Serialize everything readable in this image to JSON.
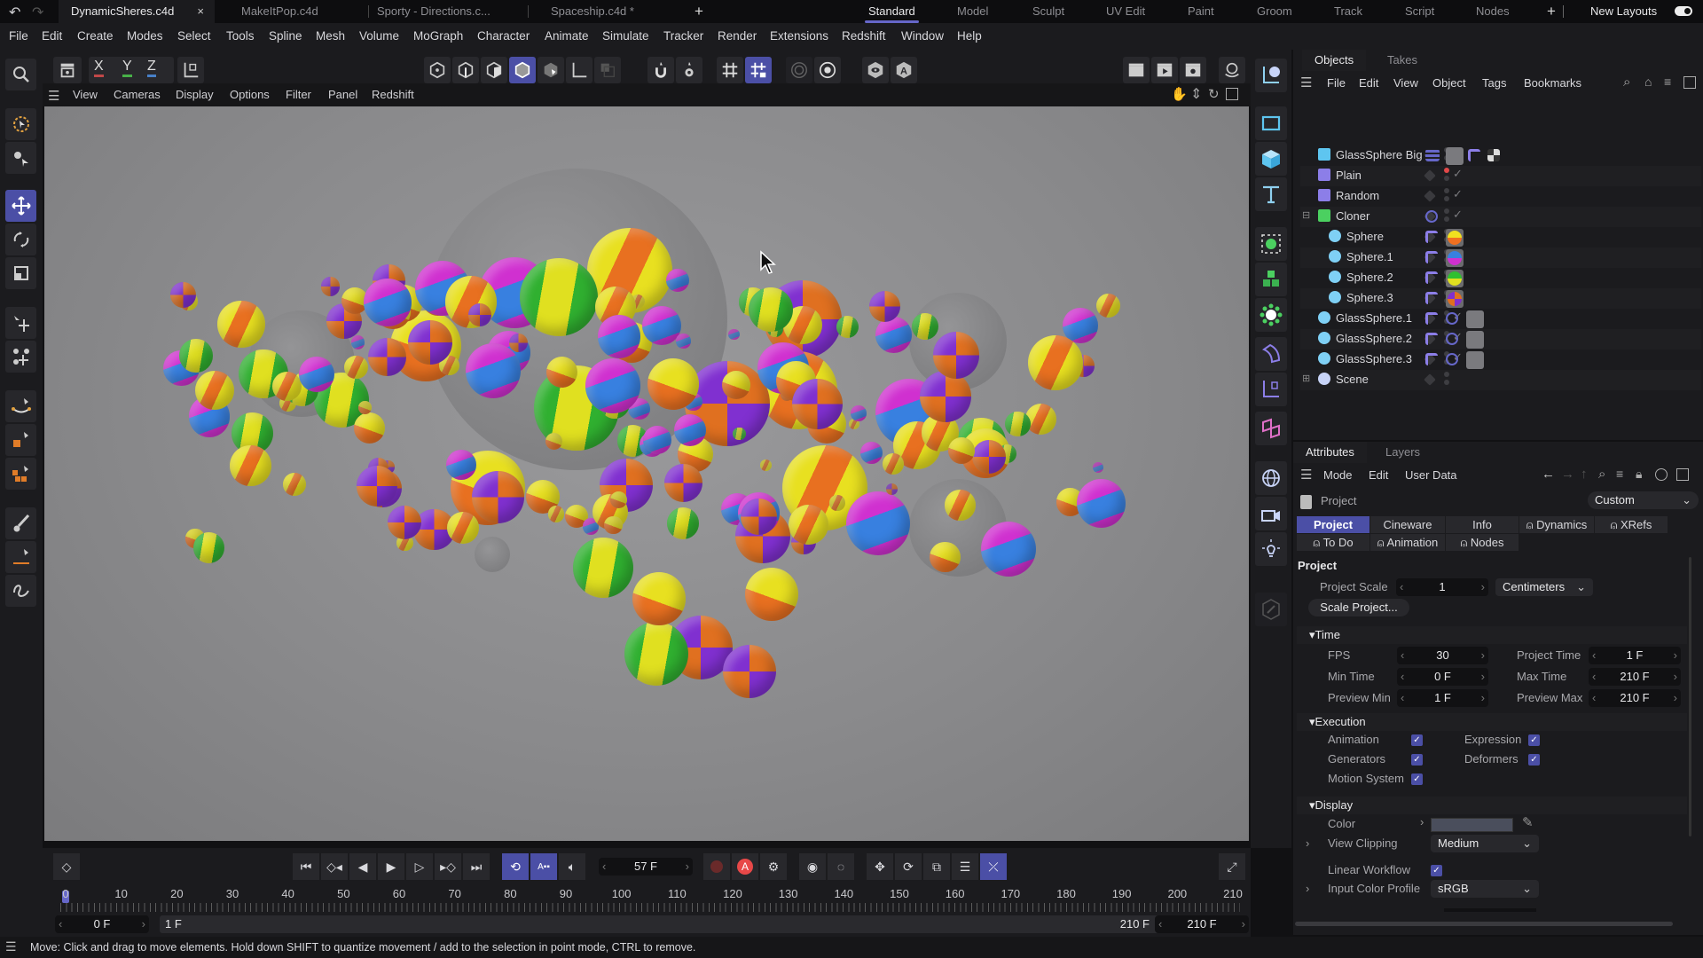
{
  "titlebar": {
    "document_tabs": [
      {
        "label": "DynamicSheres.c4d",
        "active": true,
        "close": "×"
      },
      {
        "label": "MakeItPop.c4d",
        "active": false
      },
      {
        "label": "Sporty - Directions.c...",
        "active": false
      },
      {
        "label": "Spaceship.c4d *",
        "active": false
      }
    ],
    "add_tab": "+",
    "layouts": [
      "Standard",
      "Model",
      "Sculpt",
      "UV Edit",
      "Paint",
      "Groom",
      "Track",
      "Script",
      "Nodes"
    ],
    "active_layout": "Standard",
    "add_layout": "+",
    "new_layouts_label": "New Layouts",
    "new_layouts_enabled": true
  },
  "menubar": [
    "File",
    "Edit",
    "Create",
    "Modes",
    "Select",
    "Tools",
    "Spline",
    "Mesh",
    "Volume",
    "MoGraph",
    "Character",
    "Animate",
    "Simulate",
    "Tracker",
    "Render",
    "Extensions",
    "Redshift",
    "Window",
    "Help"
  ],
  "toolbar": {
    "axis_labels": [
      "X",
      "Y",
      "Z"
    ],
    "axis_colors": [
      "#c04848",
      "#48b048",
      "#4880c8"
    ]
  },
  "viewport": {
    "menu": [
      "View",
      "Cameras",
      "Display",
      "Options",
      "Filter",
      "Panel",
      "Redshift"
    ],
    "background": "#8c8c8e"
  },
  "objects_panel": {
    "tabs": [
      "Objects",
      "Takes"
    ],
    "menu": [
      "File",
      "Edit",
      "View",
      "Object",
      "Tags",
      "Bookmarks"
    ],
    "objects": [
      {
        "name": "GlassSphere Big",
        "icon": "cone-icon",
        "indent": 0
      },
      {
        "name": "Plain",
        "icon": "plain-effector-icon",
        "indent": 0
      },
      {
        "name": "Random",
        "icon": "random-effector-icon",
        "indent": 0
      },
      {
        "name": "Cloner",
        "icon": "cloner-icon",
        "indent": 0,
        "expanded": true
      },
      {
        "name": "Sphere",
        "icon": "sphere-icon",
        "indent": 1
      },
      {
        "name": "Sphere.1",
        "icon": "sphere-icon",
        "indent": 1
      },
      {
        "name": "Sphere.2",
        "icon": "sphere-icon",
        "indent": 1
      },
      {
        "name": "Sphere.3",
        "icon": "sphere-icon",
        "indent": 1
      },
      {
        "name": "GlassSphere.1",
        "icon": "sphere-icon",
        "indent": 0
      },
      {
        "name": "GlassSphere.2",
        "icon": "sphere-icon",
        "indent": 0
      },
      {
        "name": "GlassSphere.3",
        "icon": "sphere-icon",
        "indent": 0
      },
      {
        "name": "Scene",
        "icon": "scene-icon",
        "indent": 0,
        "collapsed": true
      }
    ]
  },
  "attributes": {
    "tabs": [
      "Attributes",
      "Layers"
    ],
    "menu": [
      "Mode",
      "Edit",
      "User Data"
    ],
    "object_label": "Project",
    "preset": "Custom",
    "subtabs_row1": [
      "Project",
      "Cineware",
      "Info",
      "Dynamics",
      "XRefs"
    ],
    "subtabs_row2": [
      "To Do",
      "Animation",
      "Nodes"
    ],
    "active_subtab": "Project",
    "section_title": "Project",
    "project_scale_label": "Project Scale",
    "project_scale_value": "1",
    "project_scale_unit": "Centimeters",
    "scale_project_button": "Scale Project...",
    "time": {
      "title": "Time",
      "fps_label": "FPS",
      "fps": "30",
      "project_time_label": "Project Time",
      "project_time": "1 F",
      "min_time_label": "Min Time",
      "min_time": "0 F",
      "max_time_label": "Max Time",
      "max_time": "210 F",
      "preview_min_label": "Preview Min",
      "preview_min": "1 F",
      "preview_max_label": "Preview Max",
      "preview_max": "210 F"
    },
    "execution": {
      "title": "Execution",
      "animation": "Animation",
      "expression": "Expression",
      "generators": "Generators",
      "deformers": "Deformers",
      "motion_system": "Motion System"
    },
    "display": {
      "title": "Display",
      "color_label": "Color",
      "color_value": "#4a4e5c",
      "view_clipping_label": "View Clipping",
      "view_clipping": "Medium",
      "linear_workflow_label": "Linear Workflow",
      "input_color_profile_label": "Input Color Profile",
      "input_color_profile": "sRGB"
    }
  },
  "timeline": {
    "current_frame": "57 F",
    "ticks": [
      "0",
      "10",
      "20",
      "30",
      "40",
      "50",
      "60",
      "70",
      "80",
      "90",
      "100",
      "110",
      "120",
      "130",
      "140",
      "150",
      "160",
      "170",
      "180",
      "190",
      "200",
      "210"
    ],
    "range_start": "0 F",
    "preview_start": "1 F",
    "preview_end": "210 F",
    "range_end": "210 F"
  },
  "statusbar": {
    "message": "Move: Click and drag to move elements. Hold down SHIFT to quantize movement / add to the selection in point mode, CTRL to remove."
  }
}
